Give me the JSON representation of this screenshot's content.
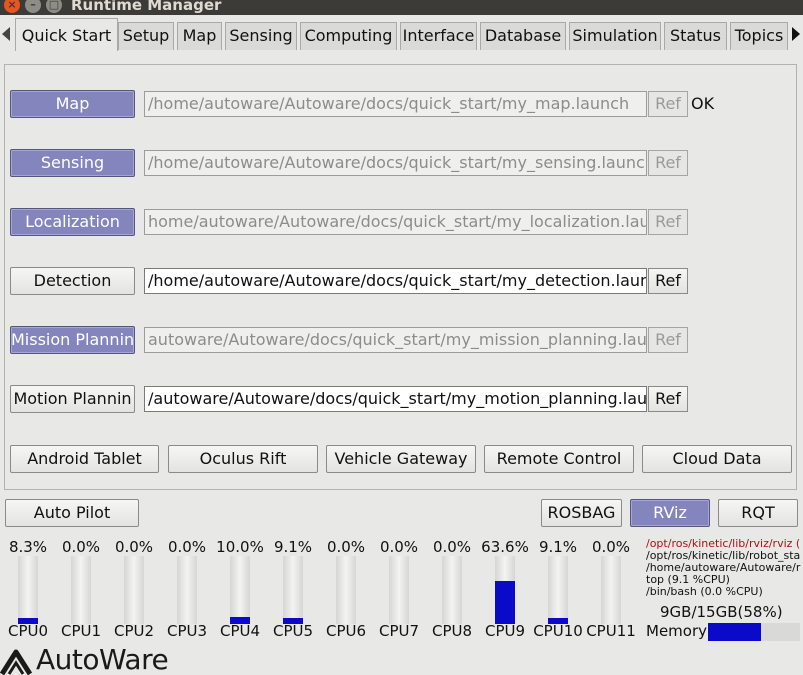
{
  "window": {
    "title": "Runtime Manager",
    "close_glyph": "×",
    "min_glyph": "–",
    "max_glyph": "□"
  },
  "tabs": [
    {
      "label": "Quick Start",
      "active": true
    },
    {
      "label": "Setup"
    },
    {
      "label": "Map"
    },
    {
      "label": "Sensing"
    },
    {
      "label": "Computing"
    },
    {
      "label": "Interface"
    },
    {
      "label": "Database"
    },
    {
      "label": "Simulation"
    },
    {
      "label": "Status"
    },
    {
      "label": "Topics"
    }
  ],
  "launch_rows": [
    {
      "button": "Map",
      "on": true,
      "path": "/home/autoware/Autoware/docs/quick_start/my_map.launch",
      "path_enabled": false,
      "ref": "Ref",
      "ref_enabled": false,
      "status": "OK"
    },
    {
      "button": "Sensing",
      "on": true,
      "path": "/home/autoware/Autoware/docs/quick_start/my_sensing.launch",
      "path_enabled": false,
      "ref": "Ref",
      "ref_enabled": false,
      "status": ""
    },
    {
      "button": "Localization",
      "on": true,
      "path": "home/autoware/Autoware/docs/quick_start/my_localization.launch",
      "path_enabled": false,
      "ref": "Ref",
      "ref_enabled": false,
      "status": ""
    },
    {
      "button": "Detection",
      "on": false,
      "path": "/home/autoware/Autoware/docs/quick_start/my_detection.launch",
      "path_enabled": true,
      "ref": "Ref",
      "ref_enabled": true,
      "status": ""
    },
    {
      "button": "Mission Plannin",
      "on": true,
      "path": "autoware/Autoware/docs/quick_start/my_mission_planning.launch",
      "path_enabled": false,
      "ref": "Ref",
      "ref_enabled": false,
      "status": ""
    },
    {
      "button": "Motion Plannin",
      "on": false,
      "path": "/autoware/Autoware/docs/quick_start/my_motion_planning.launch",
      "path_enabled": true,
      "ref": "Ref",
      "ref_enabled": true,
      "status": ""
    }
  ],
  "extra_buttons": [
    "Android Tablet",
    "Oculus Rift",
    "Vehicle Gateway",
    "Remote Control",
    "Cloud Data"
  ],
  "bottom_buttons": {
    "auto_pilot": "Auto Pilot",
    "rosbag": "ROSBAG",
    "rviz": "RViz",
    "rqt": "RQT"
  },
  "cpus": [
    {
      "label": "CPU0",
      "percent": "8.3%",
      "load": 8.3
    },
    {
      "label": "CPU1",
      "percent": "0.0%",
      "load": 0.0
    },
    {
      "label": "CPU2",
      "percent": "0.0%",
      "load": 0.0
    },
    {
      "label": "CPU3",
      "percent": "0.0%",
      "load": 0.0
    },
    {
      "label": "CPU4",
      "percent": "10.0%",
      "load": 10.0
    },
    {
      "label": "CPU5",
      "percent": "9.1%",
      "load": 9.1
    },
    {
      "label": "CPU6",
      "percent": "0.0%",
      "load": 0.0
    },
    {
      "label": "CPU7",
      "percent": "0.0%",
      "load": 0.0
    },
    {
      "label": "CPU8",
      "percent": "0.0%",
      "load": 0.0
    },
    {
      "label": "CPU9",
      "percent": "63.6%",
      "load": 63.6
    },
    {
      "label": "CPU10",
      "percent": "9.1%",
      "load": 9.1
    },
    {
      "label": "CPU11",
      "percent": "0.0%",
      "load": 0.0
    }
  ],
  "processes": [
    {
      "text": "/opt/ros/kinetic/lib/rviz/rviz (",
      "hot": true
    },
    {
      "text": "/opt/ros/kinetic/lib/robot_sta",
      "hot": false
    },
    {
      "text": "/home/autoware/Autoware/r",
      "hot": false
    },
    {
      "text": "top (9.1 %CPU)",
      "hot": false
    },
    {
      "text": "/bin/bash (0.0 %CPU)",
      "hot": false
    }
  ],
  "memory": {
    "label": "Memory",
    "text": "9GB/15GB(58%)",
    "usage": 0.58
  },
  "logo": {
    "text": "AutoWare"
  },
  "colors": {
    "accent_active": "#8585be",
    "bar_fill": "#0a0ac8",
    "hot_process": "#b01010"
  }
}
